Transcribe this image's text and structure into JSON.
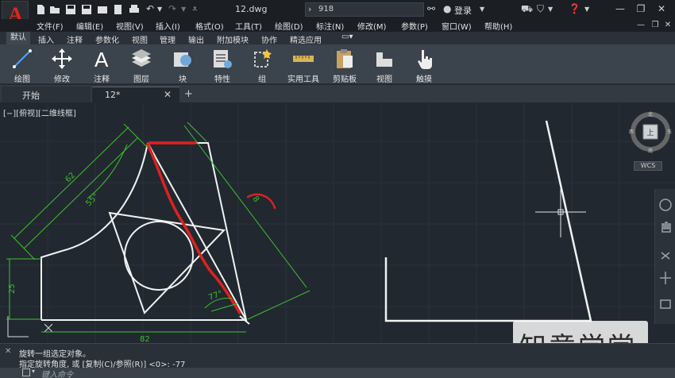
{
  "titlebar": {
    "doc_title": "12.dwg",
    "search_value": "918",
    "login_label": "登录"
  },
  "menu": [
    "文件(F)",
    "编辑(E)",
    "视图(V)",
    "插入(I)",
    "格式(O)",
    "工具(T)",
    "绘图(D)",
    "标注(N)",
    "修改(M)",
    "参数(P)",
    "窗口(W)",
    "帮助(H)"
  ],
  "ribbon_tabs": [
    "默认",
    "插入",
    "注释",
    "参数化",
    "视图",
    "管理",
    "输出",
    "附加模块",
    "协作",
    "精选应用"
  ],
  "ribbon_buttons": [
    "绘图",
    "修改",
    "注释",
    "图层",
    "块",
    "特性",
    "组",
    "实用工具",
    "剪贴板",
    "视图",
    "触摸"
  ],
  "doc_tabs": {
    "start": "开始",
    "current": "12*"
  },
  "viewport_label": "[−][俯视][二维线框]",
  "viewcube": {
    "north": "北",
    "south": "南",
    "east": "东",
    "west": "西",
    "top": "上",
    "wcs": "WCS"
  },
  "dimensions": {
    "d62": "62",
    "d55": "55°",
    "d8": "8",
    "d25": "25",
    "d82": "82",
    "d77": "77°"
  },
  "watermark": "知意学堂",
  "command": {
    "line1": "旋转一组选定对象。",
    "line2": "指定旋转角度, 或 [复制(C)/参照(R)] <0>:  -77",
    "placeholder": "键入命令"
  },
  "colors": {
    "accent": "#e1251b",
    "canvas": "#212830",
    "dim": "#3fbf2f",
    "highlight": "#e02020"
  }
}
